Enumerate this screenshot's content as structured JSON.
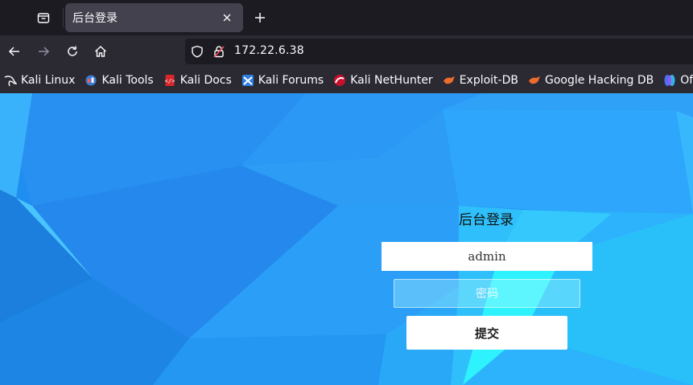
{
  "browser": {
    "tab": {
      "title": "后台登录"
    },
    "urlbar": {
      "url": "172.22.6.38"
    },
    "bookmarks": [
      {
        "label": "Kali Linux",
        "icon": "kali-dragon-icon"
      },
      {
        "label": "Kali Tools",
        "icon": "kali-tools-icon"
      },
      {
        "label": "Kali Docs",
        "icon": "kali-docs-icon"
      },
      {
        "label": "Kali Forums",
        "icon": "kali-forums-icon"
      },
      {
        "label": "Kali NetHunter",
        "icon": "nethunter-icon"
      },
      {
        "label": "Exploit-DB",
        "icon": "exploit-db-icon"
      },
      {
        "label": "Google Hacking DB",
        "icon": "ghdb-icon"
      },
      {
        "label": "OffSec",
        "icon": "offsec-icon"
      }
    ]
  },
  "login": {
    "title": "后台登录",
    "username_value": "admin",
    "password_placeholder": "密码",
    "submit_label": "提交"
  },
  "colors": {
    "background_primary": "#1e8ff2",
    "background_highlight": "#2ff2ff",
    "tab_active": "#42414d",
    "toolbar": "#2b2a33"
  }
}
